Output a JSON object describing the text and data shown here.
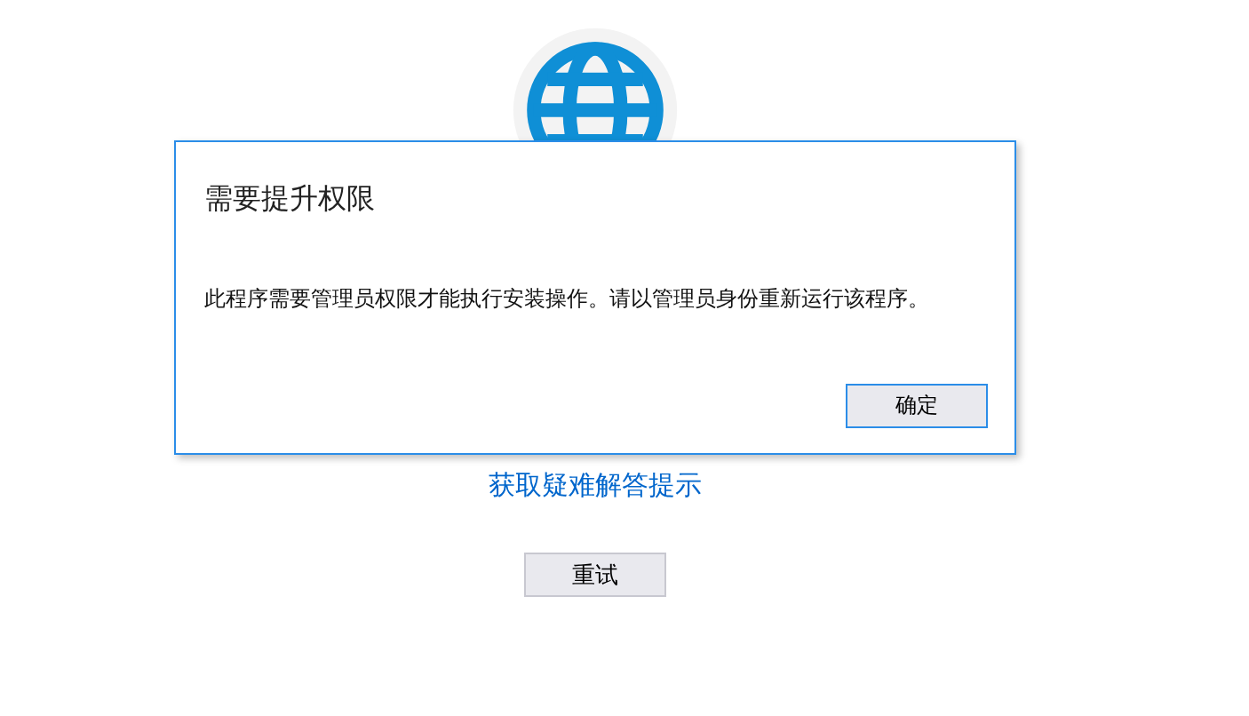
{
  "page": {
    "help_link": "获取疑难解答提示",
    "retry_button": "重试"
  },
  "dialog": {
    "title": "需要提升权限",
    "message": "此程序需要管理员权限才能执行安装操作。请以管理员身份重新运行该程序。",
    "buttons": [
      {
        "label": "确定",
        "selected": true
      }
    ]
  }
}
